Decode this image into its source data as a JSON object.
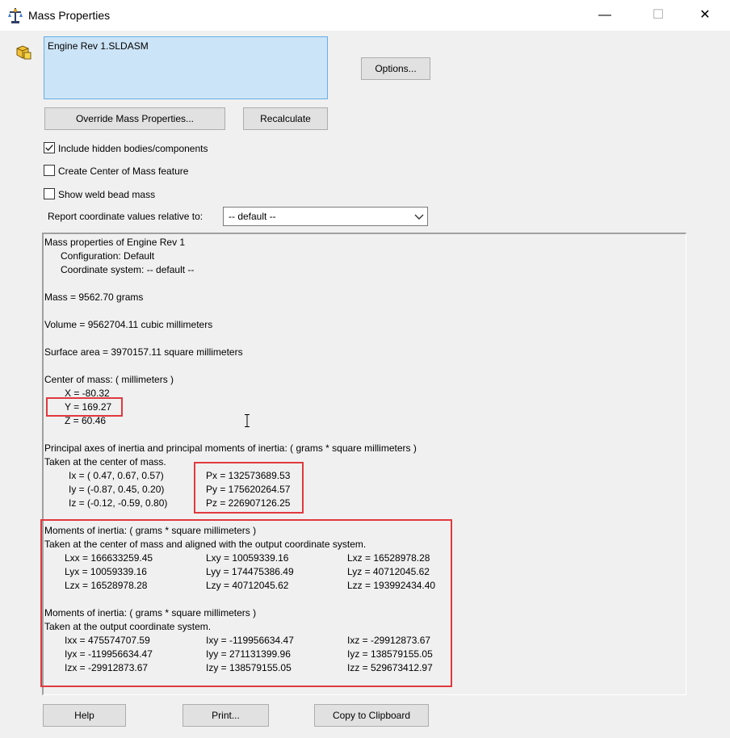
{
  "window": {
    "title": "Mass Properties",
    "minimize": "—",
    "maximize": "☐",
    "close": "✕"
  },
  "selection": {
    "item": "Engine Rev 1.SLDASM"
  },
  "buttons": {
    "options": "Options...",
    "override": "Override Mass Properties...",
    "recalculate": "Recalculate",
    "help": "Help",
    "print": "Print...",
    "copy": "Copy to Clipboard"
  },
  "checkboxes": [
    {
      "label": "Include hidden bodies/components",
      "checked": true
    },
    {
      "label": "Create Center of Mass feature",
      "checked": false
    },
    {
      "label": "Show weld bead mass",
      "checked": false
    }
  ],
  "report": {
    "label": "Report coordinate values relative to:",
    "value": "-- default --"
  },
  "results": {
    "header": "Mass properties of Engine Rev 1",
    "configuration": "Configuration: Default",
    "coord_system": "Coordinate system: -- default --",
    "mass": "Mass = 9562.70 grams",
    "volume": "Volume = 9562704.11 cubic millimeters",
    "surface_area": "Surface area = 3970157.11  square millimeters",
    "com_header": "Center of mass: ( millimeters )",
    "com_x": "X = -80.32",
    "com_y": "Y = 169.27",
    "com_z": "Z = 60.46",
    "principal_header": "Principal axes of inertia and principal moments of inertia: ( grams *  square millimeters )",
    "principal_sub": "Taken at the center of mass.",
    "principal_axes": [
      "Ix = ( 0.47,  0.67,  0.57)",
      "Iy = (-0.87,  0.45,  0.20)",
      "Iz = (-0.12, -0.59,  0.80)"
    ],
    "principal_moments": [
      "Px = 132573689.53",
      "Py = 175620264.57",
      "Pz = 226907126.25"
    ],
    "moi1_header": "Moments of inertia: ( grams *  square millimeters )",
    "moi1_sub": "Taken at the center of mass and aligned with the output coordinate system.",
    "moi1": [
      [
        "Lxx = 166633259.45",
        "Lxy = 10059339.16",
        "Lxz = 16528978.28"
      ],
      [
        "Lyx = 10059339.16",
        "Lyy = 174475386.49",
        "Lyz = 40712045.62"
      ],
      [
        "Lzx = 16528978.28",
        "Lzy = 40712045.62",
        "Lzz = 193992434.40"
      ]
    ],
    "moi2_header": "Moments of inertia: ( grams *  square millimeters )",
    "moi2_sub": "Taken at the output coordinate system.",
    "moi2": [
      [
        "Ixx = 475574707.59",
        "Ixy = -119956634.47",
        "Ixz = -29912873.67"
      ],
      [
        "Iyx = -119956634.47",
        "Iyy = 271131399.96",
        "Iyz = 138579155.05"
      ],
      [
        "Izx = -29912873.67",
        "Izy = 138579155.05",
        "Izz = 529673412.97"
      ]
    ]
  },
  "colors": {
    "highlight": "#e0393e",
    "selection_bg": "#cce4f7",
    "selection_border": "#66aee8"
  }
}
